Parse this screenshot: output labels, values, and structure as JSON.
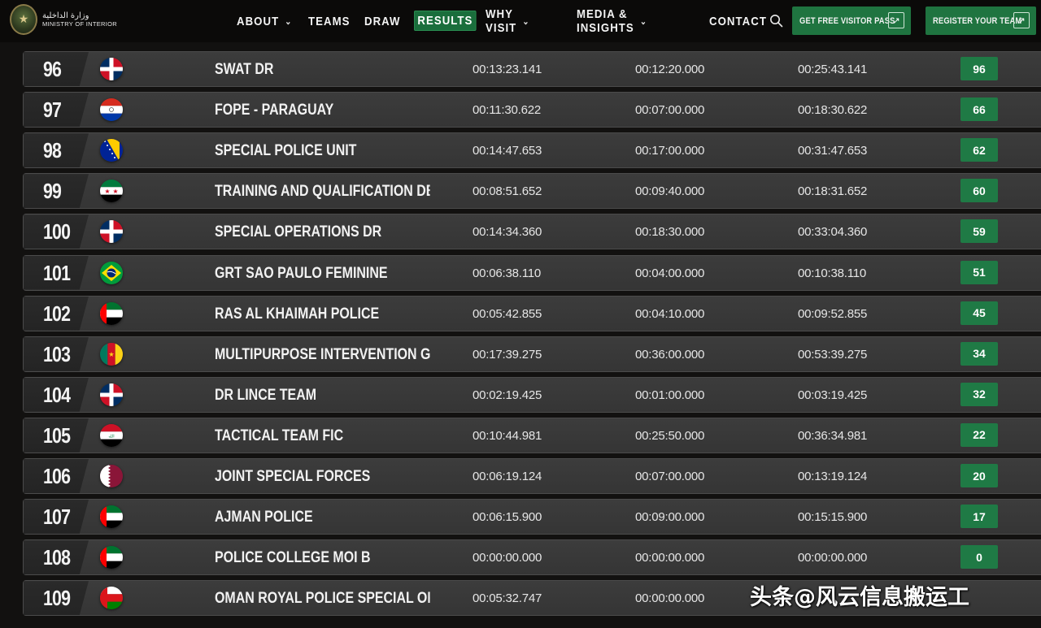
{
  "header": {
    "logo_arabic": "وزارة الداخلية",
    "logo_english": "MINISTRY OF INTERIOR",
    "menu": [
      {
        "label": "ABOUT",
        "has_dropdown": true
      },
      {
        "label": "TEAMS",
        "has_dropdown": false
      },
      {
        "label": "DRAW",
        "has_dropdown": false
      },
      {
        "label": "RESULTS",
        "has_dropdown": false,
        "active": true
      },
      {
        "label": "WHY VISIT",
        "has_dropdown": true
      },
      {
        "label": "MEDIA & INSIGHTS",
        "has_dropdown": true
      },
      {
        "label": "CONTACT",
        "has_dropdown": false
      }
    ],
    "search_icon": "search-icon",
    "cta_visitor": "GET FREE VISITOR PASS",
    "cta_register": "REGISTER YOUR TEAM",
    "accent_color": "#1f7440"
  },
  "results": {
    "rows": [
      {
        "rank": "96",
        "flag": "dominican-republic",
        "team": "SWAT DR",
        "time1": "00:13:23.141",
        "time2": "00:12:20.000",
        "time3": "00:25:43.141",
        "score": "96"
      },
      {
        "rank": "97",
        "flag": "paraguay",
        "team": "FOPE - PARAGUAY",
        "time1": "00:11:30.622",
        "time2": "00:07:00.000",
        "time3": "00:18:30.622",
        "score": "66"
      },
      {
        "rank": "98",
        "flag": "bosnia",
        "team": "SPECIAL POLICE UNIT",
        "time1": "00:14:47.653",
        "time2": "00:17:00.000",
        "time3": "00:31:47.653",
        "score": "62"
      },
      {
        "rank": "99",
        "flag": "syria",
        "team": "TRAINING AND QUALIFICATION DEPARTMENT -...",
        "time1": "00:08:51.652",
        "time2": "00:09:40.000",
        "time3": "00:18:31.652",
        "score": "60"
      },
      {
        "rank": "100",
        "flag": "dominican-republic",
        "team": "SPECIAL OPERATIONS DR",
        "time1": "00:14:34.360",
        "time2": "00:18:30.000",
        "time3": "00:33:04.360",
        "score": "59"
      },
      {
        "rank": "101",
        "flag": "brazil",
        "team": "GRT SAO PAULO FEMININE",
        "time1": "00:06:38.110",
        "time2": "00:04:00.000",
        "time3": "00:10:38.110",
        "score": "51"
      },
      {
        "rank": "102",
        "flag": "uae",
        "team": "RAS AL KHAIMAH POLICE",
        "time1": "00:05:42.855",
        "time2": "00:04:10.000",
        "time3": "00:09:52.855",
        "score": "45"
      },
      {
        "rank": "103",
        "flag": "cameroon",
        "team": "MULTIPURPOSE INTERVENTION GROUP OF THE...",
        "time1": "00:17:39.275",
        "time2": "00:36:00.000",
        "time3": "00:53:39.275",
        "score": "34"
      },
      {
        "rank": "104",
        "flag": "dominican-republic",
        "team": "DR LINCE TEAM",
        "time1": "00:02:19.425",
        "time2": "00:01:00.000",
        "time3": "00:03:19.425",
        "score": "32"
      },
      {
        "rank": "105",
        "flag": "iraq",
        "team": "TACTICAL TEAM FIC",
        "time1": "00:10:44.981",
        "time2": "00:25:50.000",
        "time3": "00:36:34.981",
        "score": "22"
      },
      {
        "rank": "106",
        "flag": "qatar",
        "team": "JOINT SPECIAL FORCES",
        "time1": "00:06:19.124",
        "time2": "00:07:00.000",
        "time3": "00:13:19.124",
        "score": "20"
      },
      {
        "rank": "107",
        "flag": "uae",
        "team": "AJMAN POLICE",
        "time1": "00:06:15.900",
        "time2": "00:09:00.000",
        "time3": "00:15:15.900",
        "score": "17"
      },
      {
        "rank": "108",
        "flag": "uae",
        "team": "POLICE COLLEGE MOI B",
        "time1": "00:00:00.000",
        "time2": "00:00:00.000",
        "time3": "00:00:00.000",
        "score": "0"
      },
      {
        "rank": "109",
        "flag": "oman",
        "team": "OMAN ROYAL POLICE SPECIAL OPERATIONS TEA...",
        "time1": "00:05:32.747",
        "time2": "00:00:00.000",
        "time3": "",
        "score": ""
      }
    ],
    "score_color": "#1f7a45"
  },
  "watermark": "头条@风云信息搬运工"
}
